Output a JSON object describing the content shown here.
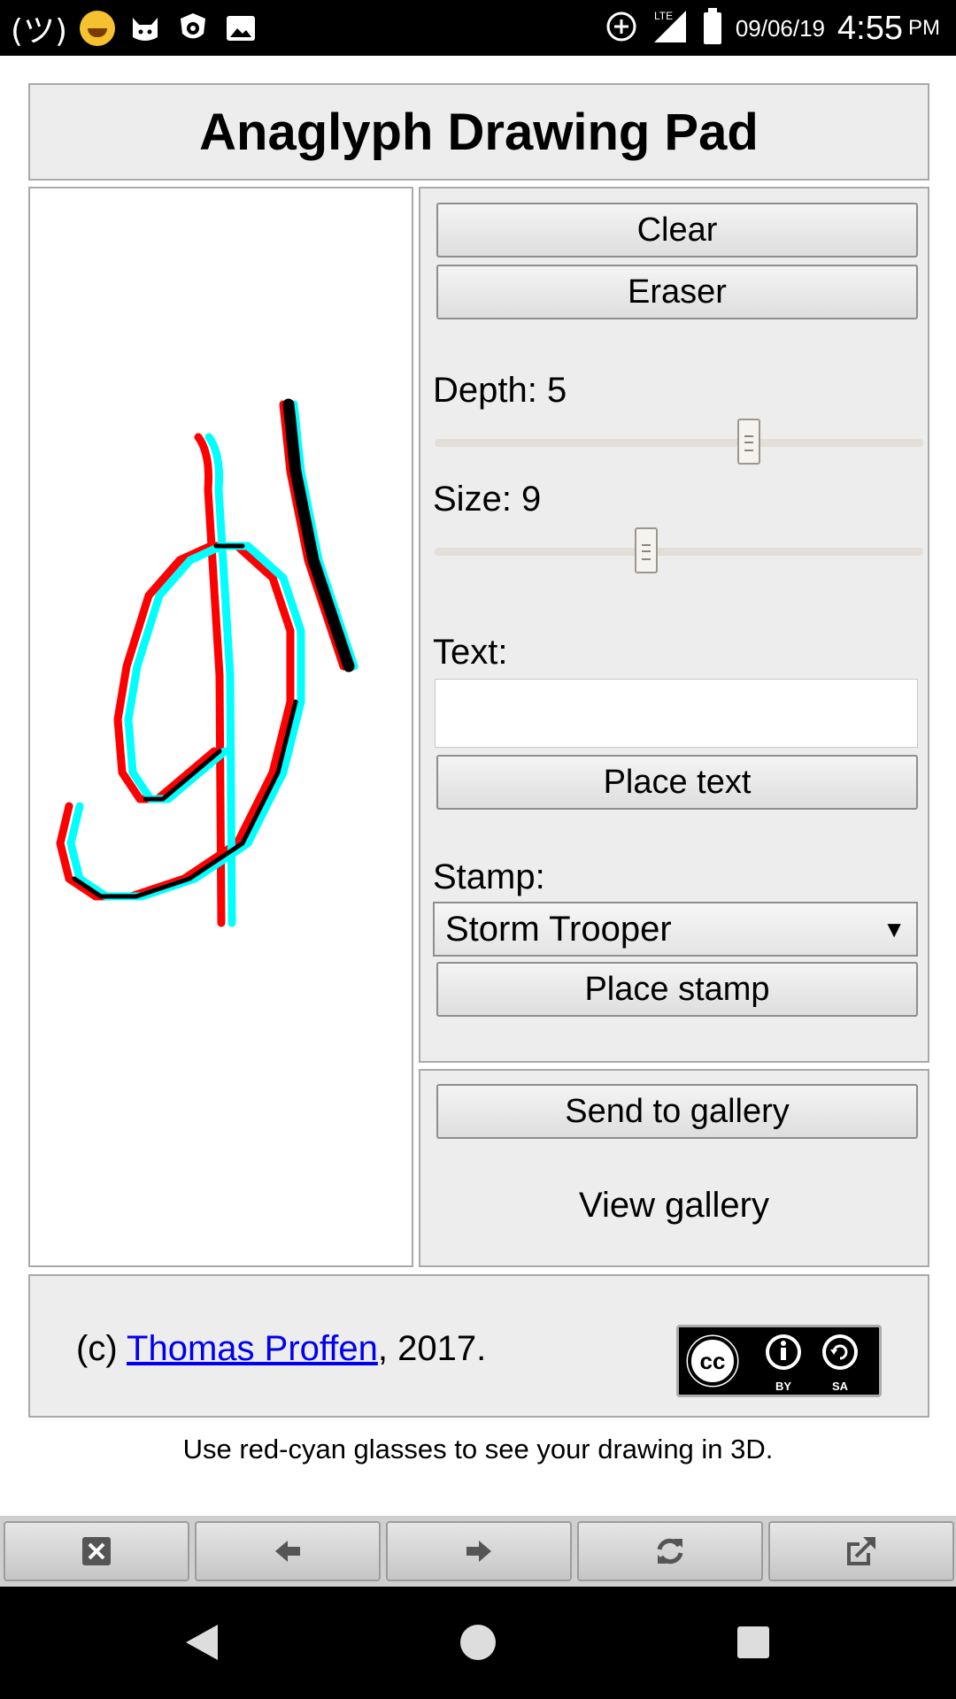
{
  "status_bar": {
    "kaomoji": "(ツ)",
    "date": "09/06/19",
    "time": "4:55",
    "ampm": "PM",
    "network": "LTE"
  },
  "page": {
    "title": "Anaglyph Drawing Pad",
    "buttons": {
      "clear": "Clear",
      "eraser": "Eraser",
      "place_text": "Place text",
      "place_stamp": "Place stamp",
      "send_to_gallery": "Send to gallery"
    },
    "depth": {
      "label": "Depth: 5",
      "value": 5,
      "fraction": 0.65
    },
    "size": {
      "label": "Size: 9",
      "value": 9,
      "fraction": 0.43
    },
    "text_field": {
      "label": "Text:",
      "value": "",
      "placeholder": ""
    },
    "stamp": {
      "label": "Stamp:",
      "selected": "Storm Trooper"
    },
    "view_gallery": "View gallery",
    "footer": {
      "prefix": "(c) ",
      "author_link": "Thomas Proffen",
      "suffix": ", 2017.",
      "license_labels": [
        "BY",
        "SA"
      ]
    },
    "hint": "Use red-cyan glasses to see your drawing in 3D."
  },
  "colors": {
    "red_channel": "#ff0000",
    "cyan_channel": "#00ffff",
    "panel_bg": "#ededed",
    "link": "#0000ee"
  },
  "toolbar": {
    "icons": [
      "close-icon",
      "back-arrow-icon",
      "forward-arrow-icon",
      "refresh-icon",
      "open-external-icon"
    ]
  },
  "navbar": {
    "icons": [
      "back-triangle-icon",
      "home-circle-icon",
      "recents-square-icon"
    ]
  }
}
